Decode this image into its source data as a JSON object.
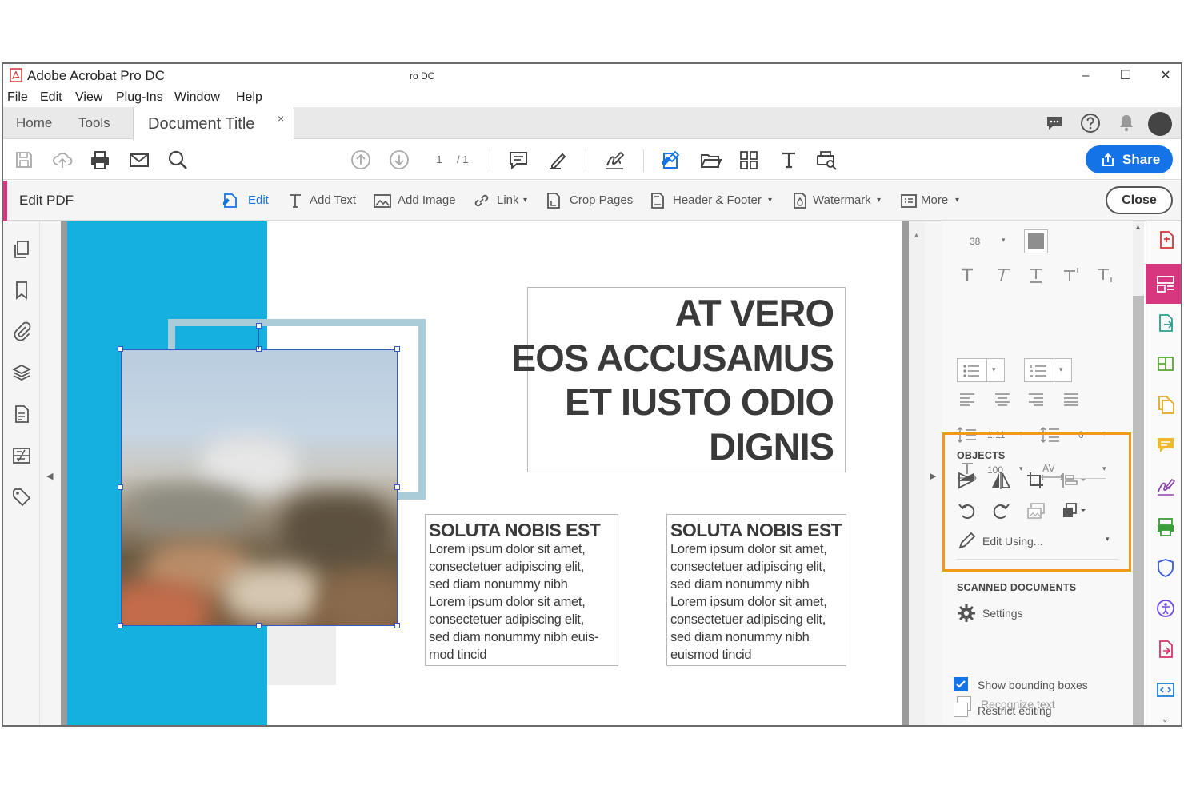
{
  "window": {
    "title": "Adobe Acrobat Pro DC",
    "center_title": "ro DC",
    "minimize": "–",
    "maximize": "☐",
    "close": "✕"
  },
  "menu": [
    "File",
    "Edit",
    "View",
    "Plug-Ins",
    "Window",
    "Help"
  ],
  "tabs": {
    "home": "Home",
    "tools": "Tools",
    "document_title": "Document Title",
    "document_close": "×"
  },
  "toolbar": {
    "page_current": "1",
    "page_total": "/ 1",
    "share_label": "Share"
  },
  "edit_bar": {
    "title": "Edit PDF",
    "edit": "Edit",
    "add_text": "Add Text",
    "add_image": "Add Image",
    "link": "Link",
    "crop_pages": "Crop Pages",
    "header_footer": "Header & Footer",
    "watermark": "Watermark",
    "more": "More",
    "close": "Close"
  },
  "document": {
    "headline": [
      "AT VERO",
      "EOS ACCUSAMUS",
      "ET IUSTO ODIO",
      "DIGNIS"
    ],
    "column_left": {
      "heading": "SOLUTA NOBIS EST",
      "lines": [
        "Lorem ipsum dolor sit amet,",
        "consectetuer adipiscing elit,",
        "sed diam nonummy nibh",
        "Lorem ipsum dolor sit amet,",
        "consectetuer adipiscing elit,",
        "sed diam nonummy nibh euis-",
        "mod tincid"
      ]
    },
    "column_right": {
      "heading": "SOLUTA NOBIS EST",
      "lines": [
        "Lorem ipsum dolor sit amet,",
        "consectetuer adipiscing elit,",
        "sed diam nonummy nibh",
        "Lorem ipsum dolor sit amet,",
        "consectetuer adipiscing elit,",
        "sed diam nonummy nibh",
        "euismod tincid"
      ]
    }
  },
  "format_panel": {
    "font_size": "38",
    "line_spacing": "1.11",
    "paragraph_spacing": "0",
    "horizontal_scale": "100",
    "objects_title": "OBJECTS",
    "edit_using": "Edit Using...",
    "scanned_title": "SCANNED DOCUMENTS",
    "settings": "Settings",
    "recognize_text": "Recognize text",
    "show_bounding_boxes": "Show bounding boxes",
    "restrict_editing": "Restrict editing",
    "show_bounding_boxes_checked": true,
    "restrict_editing_checked": false
  },
  "colors": {
    "accent_pink": "#d7377e",
    "share_blue": "#1473e6",
    "band_blue": "#16b0de",
    "highlight_orange": "#ef9a1a"
  }
}
